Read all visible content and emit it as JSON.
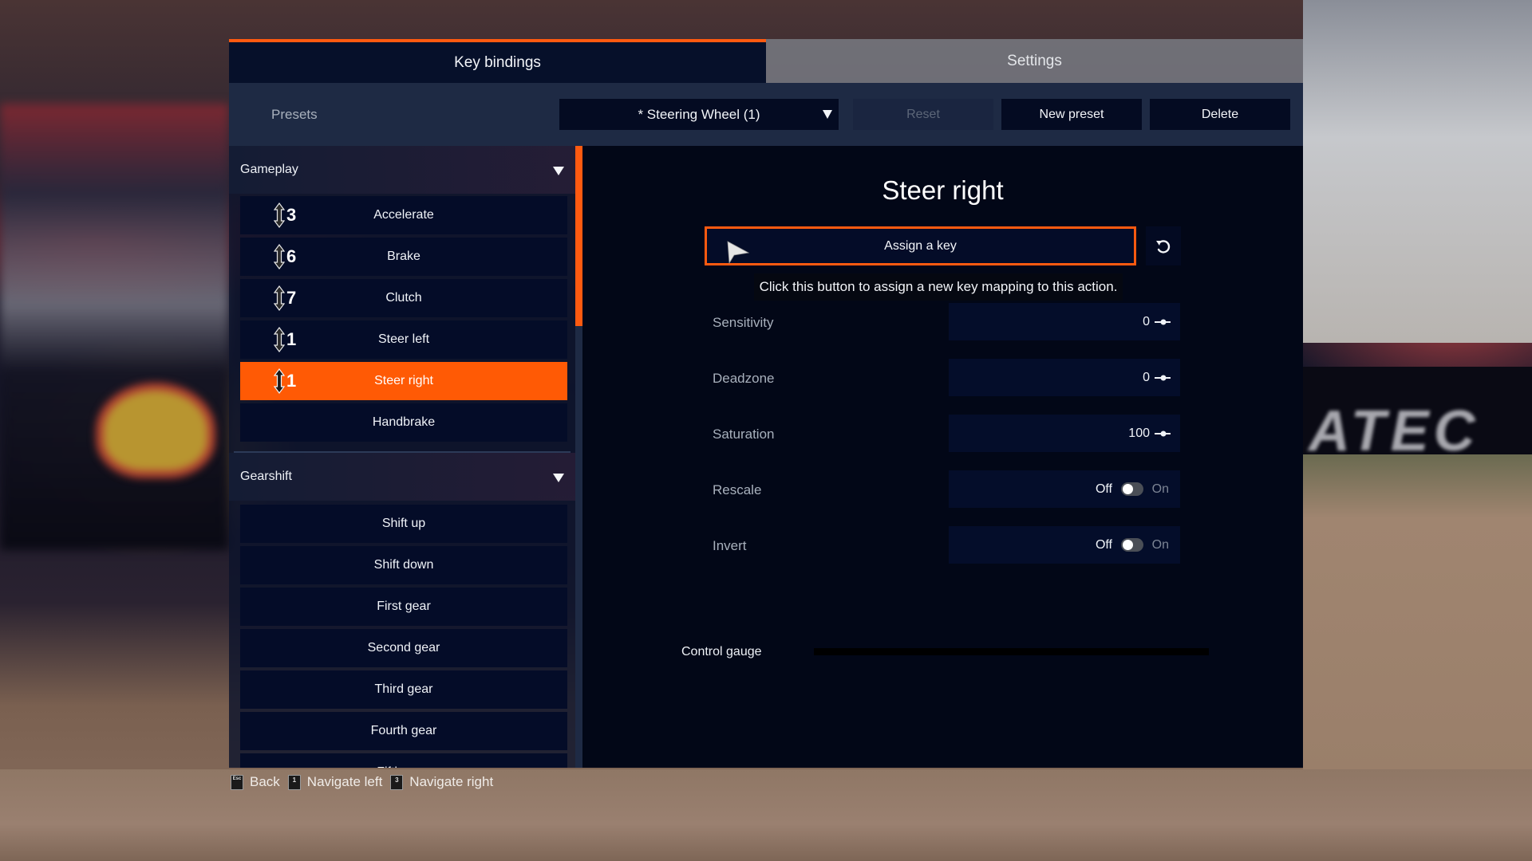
{
  "background": {
    "banner_text": "ATEC"
  },
  "tabs": [
    {
      "label": "Key bindings",
      "active": true
    },
    {
      "label": "Settings",
      "active": false
    }
  ],
  "presets": {
    "label": "Presets",
    "selected": "* Steering Wheel (1)",
    "reset_label": "Reset",
    "new_label": "New preset",
    "delete_label": "Delete"
  },
  "groups": [
    {
      "title": "Gameplay",
      "expanded": true,
      "actions": [
        {
          "label": "Accelerate",
          "binding": "3",
          "binding_icon": "axis-updown-icon"
        },
        {
          "label": "Brake",
          "binding": "6",
          "binding_icon": "axis-updown-icon"
        },
        {
          "label": "Clutch",
          "binding": "7",
          "binding_icon": "axis-updown-icon"
        },
        {
          "label": "Steer left",
          "binding": "1",
          "binding_icon": "axis-updown-icon"
        },
        {
          "label": "Steer right",
          "binding": "1",
          "binding_icon": "axis-updown-icon",
          "selected": true
        },
        {
          "label": "Handbrake",
          "binding": ""
        }
      ]
    },
    {
      "title": "Gearshift",
      "expanded": true,
      "actions": [
        {
          "label": "Shift up"
        },
        {
          "label": "Shift down"
        },
        {
          "label": "First gear"
        },
        {
          "label": "Second gear"
        },
        {
          "label": "Third gear"
        },
        {
          "label": "Fourth gear"
        },
        {
          "label": "Fifth gear"
        }
      ]
    }
  ],
  "scroll": {
    "position_fraction": 0.0,
    "visible_fraction": 0.29
  },
  "detail": {
    "title": "Steer right",
    "assign_label": "Assign a key",
    "tooltip": "Click this button to assign a new key mapping to this action.",
    "settings": [
      {
        "label": "Sensitivity",
        "type": "slider",
        "value": "0"
      },
      {
        "label": "Deadzone",
        "type": "slider",
        "value": "0"
      },
      {
        "label": "Saturation",
        "type": "slider",
        "value": "100"
      },
      {
        "label": "Rescale",
        "type": "toggle",
        "off_label": "Off",
        "on_label": "On",
        "state": "Off"
      },
      {
        "label": "Invert",
        "type": "toggle",
        "off_label": "Off",
        "on_label": "On",
        "state": "Off"
      }
    ],
    "gauge_label": "Control gauge",
    "gauge_value_fraction": 0.0
  },
  "footer": [
    {
      "key": "Esc",
      "label": "Back"
    },
    {
      "key": "1",
      "label": "Navigate left"
    },
    {
      "key": "3",
      "label": "Navigate right"
    }
  ],
  "colors": {
    "accent": "#ff5a10",
    "panel_dark": "#040c28",
    "bar": "#1e2a44"
  }
}
